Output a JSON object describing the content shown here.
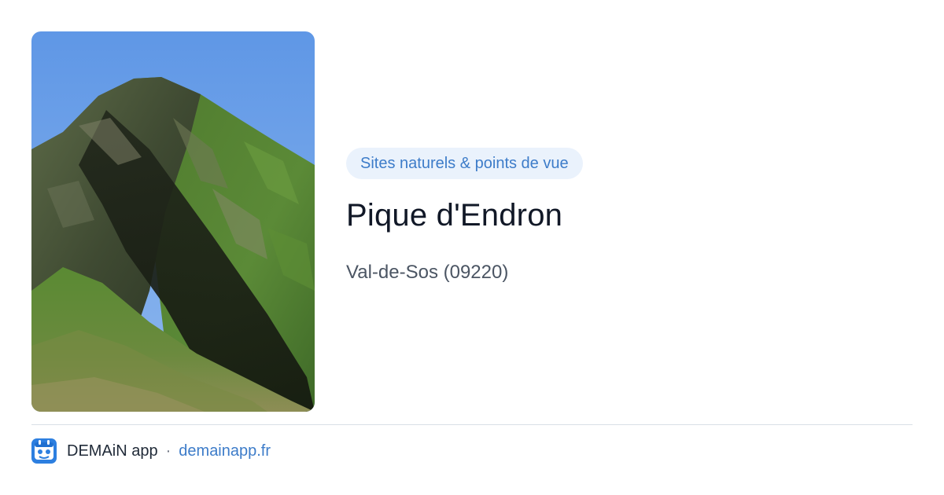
{
  "category": "Sites naturels & points de vue",
  "title": "Pique d'Endron",
  "location": "Val-de-Sos (09220)",
  "footer": {
    "app_name": "DEMAiN app",
    "separator": "·",
    "domain": "demainapp.fr",
    "app_icon": "demain-app-logo-icon"
  },
  "photo": {
    "subject": "mountain-peak-photo"
  },
  "colors": {
    "accent": "#3d7cc9",
    "chip_bg": "#eaf2fc",
    "title": "#111827",
    "muted": "#4b5563",
    "divider": "#d9e0e6"
  }
}
